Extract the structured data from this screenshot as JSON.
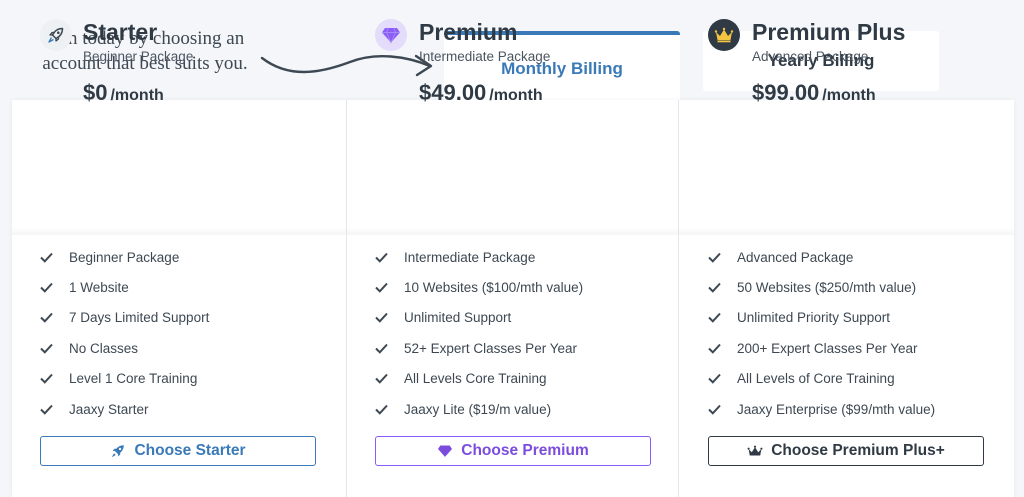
{
  "intro_text": "Join today by choosing an account that best suits you.",
  "tabs": [
    {
      "label": "Monthly Billing"
    },
    {
      "label": "Yearly Billing"
    }
  ],
  "plans": [
    {
      "name": "Starter",
      "subtitle": "Beginner Package",
      "price": "$0",
      "period": "/month",
      "icon": "rocket-icon",
      "features": [
        "Beginner Package",
        "1 Website",
        "7 Days Limited Support",
        "No Classes",
        "Level 1 Core Training",
        "Jaaxy Starter"
      ],
      "button_label": "Choose Starter"
    },
    {
      "name": "Premium",
      "subtitle": "Intermediate Package",
      "price": "$49.00",
      "period": "/month",
      "icon": "diamond-icon",
      "features": [
        "Intermediate Package",
        "10 Websites ($100/mth value)",
        "Unlimited Support",
        "52+ Expert Classes Per Year",
        "All Levels Core Training",
        "Jaaxy Lite ($19/m value)"
      ],
      "button_label": "Choose Premium"
    },
    {
      "name": "Premium Plus",
      "subtitle": "Advanced Package",
      "price": "$99.00",
      "period": "/month",
      "icon": "crown-icon",
      "features": [
        "Advanced Package",
        "50 Websites ($250/mth value)",
        "Unlimited Priority Support",
        "200+ Expert Classes Per Year",
        "All Levels of Core Training",
        "Jaaxy Enterprise ($99/mth value)"
      ],
      "button_label": "Choose Premium Plus+"
    }
  ],
  "colors": {
    "accent_blue": "#3a7ab8",
    "accent_purple": "#8b5cf6",
    "crown_gold": "#f5c542",
    "text_dark": "#2f3a45",
    "background": "#f4f6f9"
  }
}
